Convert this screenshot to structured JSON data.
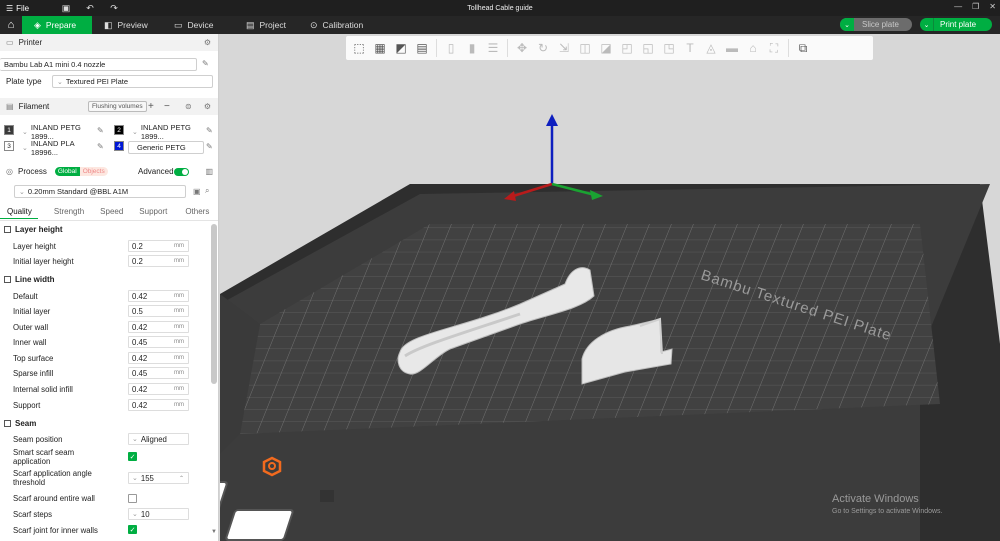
{
  "titlebar": {
    "file_label": "File",
    "title": "Tollhead Cable guide"
  },
  "tabs": [
    {
      "label": "Prepare",
      "icon": "cube-icon"
    },
    {
      "label": "Preview",
      "icon": "preview-icon"
    },
    {
      "label": "Device",
      "icon": "device-icon"
    },
    {
      "label": "Project",
      "icon": "project-icon"
    },
    {
      "label": "Calibration",
      "icon": "calibration-icon"
    }
  ],
  "actions": {
    "slice": "Slice plate",
    "print": "Print plate"
  },
  "printer": {
    "header": "Printer",
    "name": "Bambu Lab A1 mini 0.4 nozzle",
    "plate_type_label": "Plate type",
    "plate_type_value": "Textured PEI Plate"
  },
  "filament": {
    "header": "Filament",
    "flushing": "Flushing volumes",
    "items": [
      {
        "num": "1",
        "name": "INLAND PETG 1899...",
        "color": "#3a3a3a"
      },
      {
        "num": "2",
        "name": "INLAND PETG 1899...",
        "color": "#000000"
      },
      {
        "num": "3",
        "name": "INLAND PLA 18996...",
        "color": "#ffffff"
      },
      {
        "num": "4",
        "name": "Generic PETG",
        "color": "#0018d6"
      }
    ]
  },
  "process": {
    "header": "Process",
    "global": "Global",
    "objects": "Objects",
    "advanced": "Advanced",
    "preset": "0.20mm Standard @BBL A1M",
    "tabs": [
      "Quality",
      "Strength",
      "Speed",
      "Support",
      "Others"
    ]
  },
  "groups": {
    "layer_height": "Layer height",
    "line_width": "Line width",
    "seam": "Seam"
  },
  "params": {
    "layer_height": {
      "label": "Layer height",
      "value": "0.2",
      "unit": "mm"
    },
    "initial_layer_height": {
      "label": "Initial layer height",
      "value": "0.2",
      "unit": "mm"
    },
    "default": {
      "label": "Default",
      "value": "0.42",
      "unit": "mm"
    },
    "initial_layer": {
      "label": "Initial layer",
      "value": "0.5",
      "unit": "mm"
    },
    "outer_wall": {
      "label": "Outer wall",
      "value": "0.42",
      "unit": "mm"
    },
    "inner_wall": {
      "label": "Inner wall",
      "value": "0.45",
      "unit": "mm"
    },
    "top_surface": {
      "label": "Top surface",
      "value": "0.42",
      "unit": "mm"
    },
    "sparse_infill": {
      "label": "Sparse infill",
      "value": "0.45",
      "unit": "mm"
    },
    "internal_solid_infill": {
      "label": "Internal solid infill",
      "value": "0.42",
      "unit": "mm"
    },
    "support": {
      "label": "Support",
      "value": "0.42",
      "unit": "mm"
    },
    "seam_position": {
      "label": "Seam position",
      "value": "Aligned"
    },
    "smart_scarf": {
      "label": "Smart scarf seam application",
      "checked": true
    },
    "scarf_angle": {
      "label": "Scarf application angle threshold",
      "value": "155"
    },
    "scarf_entire": {
      "label": "Scarf around entire wall",
      "checked": false
    },
    "scarf_steps": {
      "label": "Scarf steps",
      "value": "10"
    },
    "scarf_inner": {
      "label": "Scarf joint for inner walls",
      "checked": true
    }
  },
  "viewport": {
    "plate_label": "Bambu Textured PEI Plate",
    "watermark_title": "Activate Windows",
    "watermark_sub": "Go to Settings to activate Windows."
  }
}
